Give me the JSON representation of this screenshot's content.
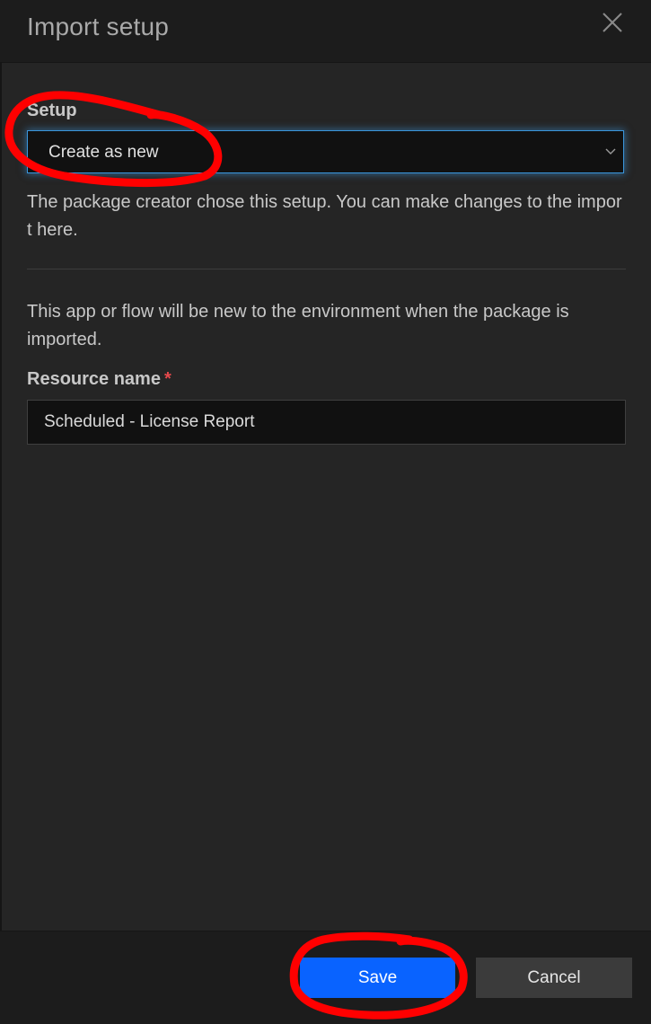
{
  "dialog": {
    "title": "Import setup"
  },
  "setup": {
    "label": "Setup",
    "selected": "Create as new",
    "help_text": "The package creator chose this setup. You can make changes to the import here."
  },
  "info": {
    "text": "This app or flow will be new to the environment when the package is imported."
  },
  "resource": {
    "label": "Resource name",
    "required_mark": "*",
    "value": "Scheduled - License Report"
  },
  "footer": {
    "save_label": "Save",
    "cancel_label": "Cancel"
  },
  "colors": {
    "primary_button": "#0963ff",
    "focus_border": "#3a96dd",
    "required": "#e5494c",
    "annotation_marker": "#ff0000"
  },
  "icons": {
    "close": "close-icon",
    "dropdown": "chevron-down-icon"
  }
}
